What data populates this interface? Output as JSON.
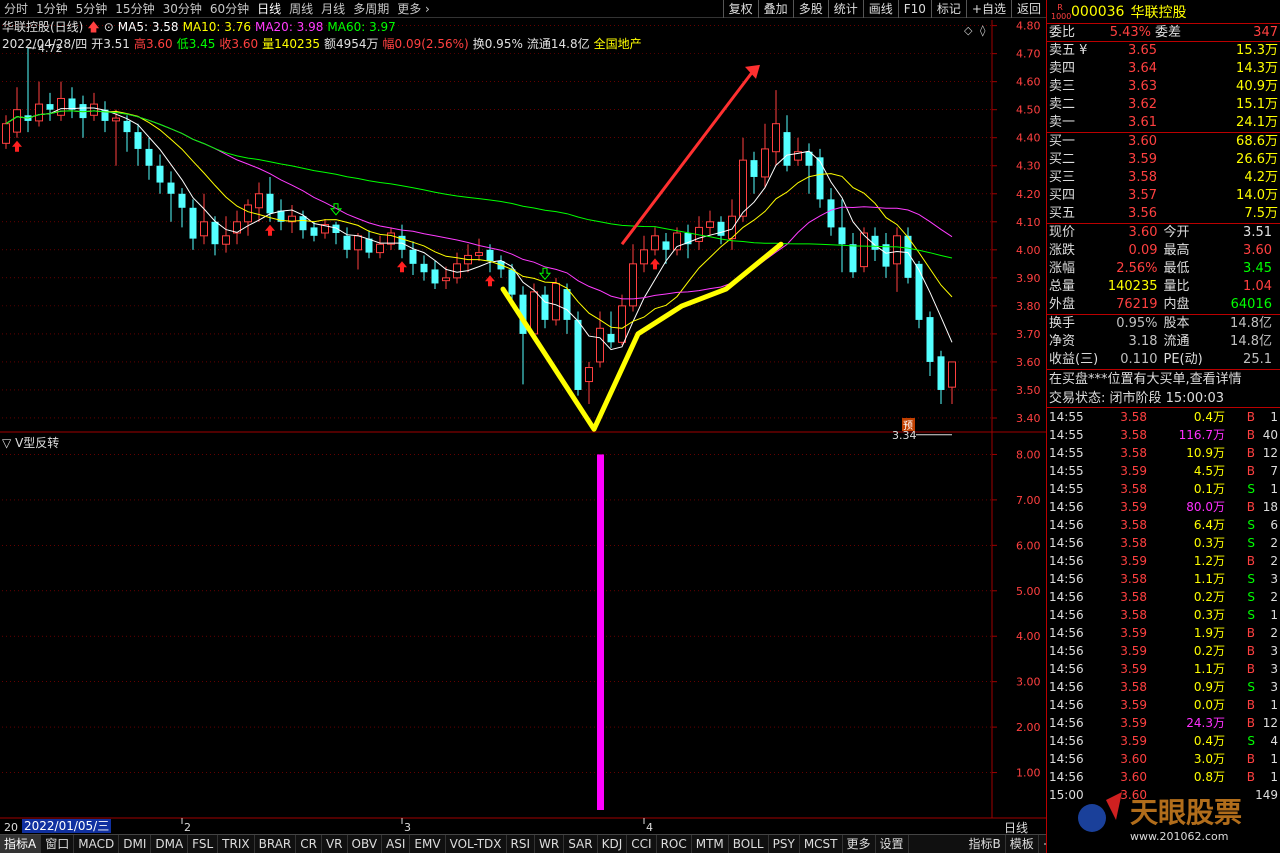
{
  "toolbar": {
    "periods": [
      "分时",
      "1分钟",
      "5分钟",
      "15分钟",
      "30分钟",
      "60分钟",
      "日线",
      "周线",
      "月线",
      "多周期",
      "更多"
    ],
    "active": "日线",
    "right_buttons": [
      "复权",
      "叠加",
      "多股",
      "统计",
      "画线",
      "F10",
      "标记",
      "+自选",
      "返回"
    ]
  },
  "header": {
    "stock": "华联控股(日线)",
    "ma5": "MA5: 3.58",
    "ma10": "MA10: 3.76",
    "ma20": "MA20: 3.98",
    "ma60": "MA60: 3.97",
    "date": "2022/04/28/四",
    "open": "开3.51",
    "high": "高3.60",
    "low": "低3.45",
    "close": "收3.60",
    "volume": "量140235",
    "amount": "额4954万",
    "change": "幅0.09(2.56%)",
    "turnover": "换0.95%",
    "float": "流通14.8亿",
    "sector": "全国地产"
  },
  "sub_header": {
    "indicator_title": "V型反转"
  },
  "annotations": {
    "high_mark": "4.72",
    "low_mark": "3.34",
    "forecast": "预"
  },
  "price_axis": [
    "4.80",
    "4.70",
    "4.60",
    "4.50",
    "4.40",
    "4.30",
    "4.20",
    "4.10",
    "4.00",
    "3.90",
    "3.80",
    "3.70",
    "3.60",
    "3.50",
    "3.40"
  ],
  "sub_axis": [
    "8.00",
    "7.00",
    "6.00",
    "5.00",
    "4.00",
    "3.00",
    "2.00",
    "1.00"
  ],
  "x_axis": {
    "start": "20",
    "date_cursor": "2022/01/05/三",
    "months": [
      "2",
      "3",
      "4"
    ],
    "period": "日线"
  },
  "bottom_tabs": [
    "指标A",
    "窗口",
    "MACD",
    "DMI",
    "DMA",
    "FSL",
    "TRIX",
    "BRAR",
    "CR",
    "VR",
    "OBV",
    "ASI",
    "EMV",
    "VOL-TDX",
    "RSI",
    "WR",
    "SAR",
    "KDJ",
    "CCI",
    "ROC",
    "MTM",
    "BOLL",
    "PSY",
    "MCST",
    "更多",
    "设置",
    "指标B",
    "模板"
  ],
  "colors": {
    "up": "#ff4040",
    "down": "#54ffff",
    "ma5": "#ffffff",
    "ma10": "#ffff00",
    "ma20": "#ff3cff",
    "ma60": "#00ff00",
    "grid": "#a00000",
    "signal": "#ff00ff",
    "drawn_v": "#ffff00",
    "drawn_arrow": "#ff3030"
  },
  "right_panel": {
    "logo": "R 1000",
    "code": "000036",
    "name": "华联控股",
    "ratio": {
      "label": "委比",
      "value": "5.43%",
      "label2": "委差",
      "value2": "347"
    },
    "asks": [
      {
        "label": "卖五 ¥",
        "price": "3.65",
        "vol": "15.3万"
      },
      {
        "label": "卖四",
        "price": "3.64",
        "vol": "14.3万"
      },
      {
        "label": "卖三",
        "price": "3.63",
        "vol": "40.9万"
      },
      {
        "label": "卖二",
        "price": "3.62",
        "vol": "15.1万"
      },
      {
        "label": "卖一",
        "price": "3.61",
        "vol": "24.1万"
      }
    ],
    "bids": [
      {
        "label": "买一",
        "price": "3.60",
        "vol": "68.6万"
      },
      {
        "label": "买二",
        "price": "3.59",
        "vol": "26.6万"
      },
      {
        "label": "买三",
        "price": "3.58",
        "vol": "4.2万"
      },
      {
        "label": "买四",
        "price": "3.57",
        "vol": "14.0万"
      },
      {
        "label": "买五",
        "price": "3.56",
        "vol": "7.5万"
      }
    ],
    "quote": [
      {
        "l1": "现价",
        "v1": "3.60",
        "c1": "red",
        "l2": "今开",
        "v2": "3.51",
        "c2": "white"
      },
      {
        "l1": "涨跌",
        "v1": "0.09",
        "c1": "red",
        "l2": "最高",
        "v2": "3.60",
        "c2": "red"
      },
      {
        "l1": "涨幅",
        "v1": "2.56%",
        "c1": "red",
        "l2": "最低",
        "v2": "3.45",
        "c2": "green"
      },
      {
        "l1": "总量",
        "v1": "140235",
        "c1": "yellow",
        "l2": "量比",
        "v2": "1.04",
        "c2": "red"
      },
      {
        "l1": "外盘",
        "v1": "76219",
        "c1": "red",
        "l2": "内盘",
        "v2": "64016",
        "c2": "green"
      }
    ],
    "fund": [
      {
        "l1": "换手",
        "v1": "0.95%",
        "l2": "股本",
        "v2": "14.8亿"
      },
      {
        "l1": "净资",
        "v1": "3.18",
        "l2": "流通",
        "v2": "14.8亿"
      },
      {
        "l1": "收益(三)",
        "v1": "0.110",
        "l2": "PE(动)",
        "v2": "25.1"
      }
    ],
    "notice": "在买盘***位置有大买单,查看详情",
    "status": "交易状态: 闭市阶段 15:00:03",
    "ticks": [
      {
        "t": "14:55",
        "p": "3.58",
        "v": "0.4万",
        "bs": "B",
        "n": "1"
      },
      {
        "t": "14:55",
        "p": "3.58",
        "v": "116.7万",
        "bs": "B",
        "n": "40"
      },
      {
        "t": "14:55",
        "p": "3.58",
        "v": "10.9万",
        "bs": "B",
        "n": "12"
      },
      {
        "t": "14:55",
        "p": "3.59",
        "v": "4.5万",
        "bs": "B",
        "n": "7"
      },
      {
        "t": "14:55",
        "p": "3.58",
        "v": "0.1万",
        "bs": "S",
        "n": "1"
      },
      {
        "t": "14:56",
        "p": "3.59",
        "v": "80.0万",
        "bs": "B",
        "n": "18"
      },
      {
        "t": "14:56",
        "p": "3.58",
        "v": "6.4万",
        "bs": "S",
        "n": "6"
      },
      {
        "t": "14:56",
        "p": "3.58",
        "v": "0.3万",
        "bs": "S",
        "n": "2"
      },
      {
        "t": "14:56",
        "p": "3.59",
        "v": "1.2万",
        "bs": "B",
        "n": "2"
      },
      {
        "t": "14:56",
        "p": "3.58",
        "v": "1.1万",
        "bs": "S",
        "n": "3"
      },
      {
        "t": "14:56",
        "p": "3.58",
        "v": "0.2万",
        "bs": "S",
        "n": "2"
      },
      {
        "t": "14:56",
        "p": "3.58",
        "v": "0.3万",
        "bs": "S",
        "n": "1"
      },
      {
        "t": "14:56",
        "p": "3.59",
        "v": "1.9万",
        "bs": "B",
        "n": "2"
      },
      {
        "t": "14:56",
        "p": "3.59",
        "v": "0.2万",
        "bs": "B",
        "n": "3"
      },
      {
        "t": "14:56",
        "p": "3.59",
        "v": "1.1万",
        "bs": "B",
        "n": "3"
      },
      {
        "t": "14:56",
        "p": "3.58",
        "v": "0.9万",
        "bs": "S",
        "n": "3"
      },
      {
        "t": "14:56",
        "p": "3.59",
        "v": "0.0万",
        "bs": "B",
        "n": "1"
      },
      {
        "t": "14:56",
        "p": "3.59",
        "v": "24.3万",
        "bs": "B",
        "n": "12"
      },
      {
        "t": "14:56",
        "p": "3.59",
        "v": "0.4万",
        "bs": "S",
        "n": "4"
      },
      {
        "t": "14:56",
        "p": "3.60",
        "v": "3.0万",
        "bs": "B",
        "n": "1"
      },
      {
        "t": "14:56",
        "p": "3.60",
        "v": "0.8万",
        "bs": "B",
        "n": "1"
      },
      {
        "t": "15:00",
        "p": "3.60",
        "v": "",
        "bs": "",
        "n": "149"
      }
    ]
  },
  "watermark": {
    "text": "天眼股票",
    "url": "www.201062.com"
  },
  "chart_data": {
    "type": "candlestick",
    "y_range": [
      3.35,
      4.82
    ],
    "candles": [
      [
        4.38,
        4.45,
        4.36,
        4.48
      ],
      [
        4.42,
        4.5,
        4.4,
        4.58
      ],
      [
        4.48,
        4.46,
        4.42,
        4.72
      ],
      [
        4.46,
        4.52,
        4.44,
        4.6
      ],
      [
        4.52,
        4.5,
        4.46,
        4.56
      ],
      [
        4.48,
        4.54,
        4.46,
        4.6
      ],
      [
        4.54,
        4.5,
        4.47,
        4.58
      ],
      [
        4.52,
        4.47,
        4.4,
        4.55
      ],
      [
        4.48,
        4.52,
        4.46,
        4.56
      ],
      [
        4.5,
        4.46,
        4.42,
        4.53
      ],
      [
        4.46,
        4.47,
        4.3,
        4.5
      ],
      [
        4.46,
        4.42,
        4.35,
        4.48
      ],
      [
        4.42,
        4.36,
        4.3,
        4.45
      ],
      [
        4.36,
        4.3,
        4.25,
        4.4
      ],
      [
        4.3,
        4.24,
        4.2,
        4.34
      ],
      [
        4.24,
        4.2,
        4.1,
        4.28
      ],
      [
        4.2,
        4.15,
        4.08,
        4.22
      ],
      [
        4.15,
        4.04,
        4.0,
        4.18
      ],
      [
        4.05,
        4.1,
        4.02,
        4.2
      ],
      [
        4.1,
        4.02,
        3.98,
        4.12
      ],
      [
        4.02,
        4.05,
        3.99,
        4.12
      ],
      [
        4.06,
        4.1,
        4.02,
        4.14
      ],
      [
        4.1,
        4.16,
        4.05,
        4.18
      ],
      [
        4.15,
        4.2,
        4.1,
        4.24
      ],
      [
        4.2,
        4.13,
        4.1,
        4.26
      ],
      [
        4.14,
        4.1,
        4.07,
        4.18
      ],
      [
        4.1,
        4.12,
        4.06,
        4.16
      ],
      [
        4.12,
        4.07,
        4.04,
        4.14
      ],
      [
        4.08,
        4.05,
        4.03,
        4.1
      ],
      [
        4.06,
        4.09,
        4.04,
        4.11
      ],
      [
        4.09,
        4.06,
        4.02,
        4.1
      ],
      [
        4.05,
        4.0,
        3.97,
        4.08
      ],
      [
        4.0,
        4.05,
        3.93,
        4.06
      ],
      [
        4.04,
        3.99,
        3.97,
        4.07
      ],
      [
        3.99,
        4.02,
        3.97,
        4.05
      ],
      [
        4.02,
        4.06,
        4.0,
        4.08
      ],
      [
        4.05,
        4.0,
        3.97,
        4.09
      ],
      [
        4.0,
        3.95,
        3.91,
        4.03
      ],
      [
        3.95,
        3.92,
        3.89,
        3.98
      ],
      [
        3.93,
        3.88,
        3.86,
        3.96
      ],
      [
        3.89,
        3.9,
        3.86,
        3.94
      ],
      [
        3.9,
        3.95,
        3.88,
        3.99
      ],
      [
        3.95,
        3.98,
        3.92,
        4.02
      ],
      [
        3.98,
        3.99,
        3.96,
        4.04
      ],
      [
        4.0,
        3.96,
        3.92,
        4.02
      ],
      [
        3.96,
        3.93,
        3.9,
        3.98
      ],
      [
        3.93,
        3.84,
        3.8,
        3.95
      ],
      [
        3.84,
        3.7,
        3.52,
        3.87
      ],
      [
        3.7,
        3.85,
        3.68,
        3.88
      ],
      [
        3.84,
        3.75,
        3.72,
        3.87
      ],
      [
        3.75,
        3.88,
        3.73,
        3.9
      ],
      [
        3.86,
        3.75,
        3.7,
        3.88
      ],
      [
        3.75,
        3.5,
        3.48,
        3.78
      ],
      [
        3.53,
        3.58,
        3.45,
        3.6
      ],
      [
        3.6,
        3.72,
        3.58,
        3.78
      ],
      [
        3.7,
        3.67,
        3.65,
        3.78
      ],
      [
        3.67,
        3.8,
        3.66,
        3.84
      ],
      [
        3.8,
        3.95,
        3.78,
        4.02
      ],
      [
        3.95,
        4.0,
        3.92,
        4.05
      ],
      [
        4.0,
        4.05,
        3.98,
        4.08
      ],
      [
        4.03,
        4.0,
        3.95,
        4.06
      ],
      [
        4.0,
        4.06,
        3.98,
        4.08
      ],
      [
        4.06,
        4.02,
        3.97,
        4.09
      ],
      [
        4.03,
        4.08,
        4.0,
        4.12
      ],
      [
        4.08,
        4.1,
        4.05,
        4.14
      ],
      [
        4.1,
        4.05,
        4.02,
        4.12
      ],
      [
        4.04,
        4.12,
        4.0,
        4.18
      ],
      [
        4.12,
        4.32,
        4.1,
        4.4
      ],
      [
        4.32,
        4.26,
        4.2,
        4.35
      ],
      [
        4.26,
        4.36,
        4.22,
        4.45
      ],
      [
        4.35,
        4.45,
        4.3,
        4.57
      ],
      [
        4.42,
        4.3,
        4.28,
        4.48
      ],
      [
        4.32,
        4.35,
        4.3,
        4.4
      ],
      [
        4.35,
        4.3,
        4.2,
        4.38
      ],
      [
        4.33,
        4.18,
        4.15,
        4.36
      ],
      [
        4.18,
        4.08,
        4.05,
        4.22
      ],
      [
        4.08,
        4.02,
        3.92,
        4.18
      ],
      [
        4.02,
        3.92,
        3.9,
        4.06
      ],
      [
        3.94,
        4.06,
        3.92,
        4.08
      ],
      [
        4.05,
        4.0,
        3.96,
        4.08
      ],
      [
        4.02,
        3.94,
        3.9,
        4.06
      ],
      [
        3.95,
        4.05,
        3.85,
        4.08
      ],
      [
        4.05,
        3.9,
        3.88,
        4.08
      ],
      [
        3.95,
        3.75,
        3.72,
        3.96
      ],
      [
        3.76,
        3.6,
        3.55,
        3.78
      ],
      [
        3.62,
        3.5,
        3.45,
        3.64
      ],
      [
        3.51,
        3.6,
        3.45,
        3.6
      ]
    ],
    "signal": {
      "index": 54,
      "value": 8.0,
      "y_range": [
        0,
        8.45
      ]
    }
  }
}
